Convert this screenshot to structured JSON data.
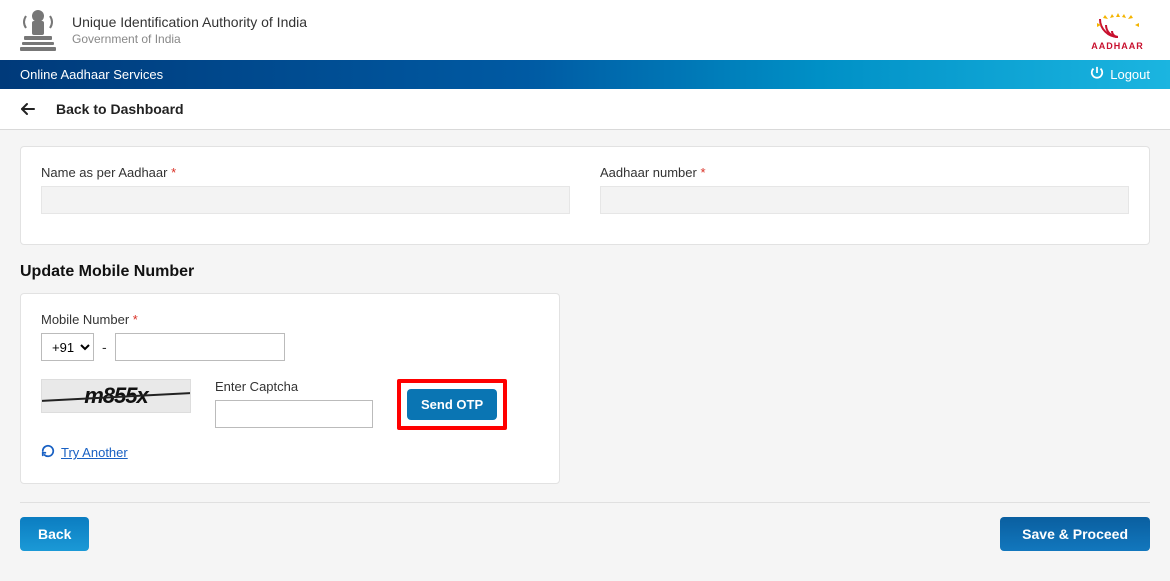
{
  "header": {
    "title": "Unique Identification Authority of India",
    "subtitle": "Government of India",
    "aadhaar_brand": "AADHAAR"
  },
  "navbar": {
    "service_title": "Online Aadhaar Services",
    "logout": "Logout"
  },
  "backrow": {
    "label": "Back to Dashboard"
  },
  "top_card": {
    "name_label": "Name as per Aadhaar",
    "aadhaar_label": "Aadhaar number",
    "name_value": "",
    "aadhaar_value": ""
  },
  "section_title": "Update Mobile Number",
  "mobile": {
    "label": "Mobile Number",
    "country_code": "+91",
    "dash": "-",
    "value": ""
  },
  "captcha": {
    "image_text": "m855x",
    "label": "Enter Captcha",
    "value": "",
    "try_another": "Try Another"
  },
  "buttons": {
    "send_otp": "Send OTP",
    "back": "Back",
    "save_proceed": "Save & Proceed"
  }
}
